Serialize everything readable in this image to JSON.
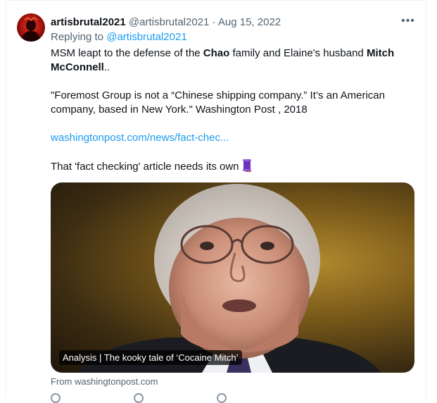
{
  "tweet": {
    "display_name": "artisbrutal2021",
    "handle": "@artisbrutal2021",
    "separator": "·",
    "date": "Aug 15, 2022",
    "more_icon": "ellipsis-icon",
    "replying_prefix": "Replying to",
    "replying_handle": "@artisbrutal2021",
    "para1": {
      "a": "MSM leapt to the defense of the ",
      "b": "Chao",
      "c": " family and Elaine's husband ",
      "d": "Mitch McConnell",
      "e": ".."
    },
    "para2": "\"Foremost Group is not a “Chinese shipping company.” It’s an American company, based in New York.\" Washington Post , 2018",
    "link": "washingtonpost.com/news/fact-chec...",
    "para4": "That 'fact checking' article needs its own",
    "para4_emoji": "scroll-emoji"
  },
  "card": {
    "caption": "Analysis | The kooky tale of ‘Cocaine Mitch’",
    "source": "From washingtonpost.com"
  },
  "colors": {
    "link": "#1d9bf0",
    "secondary_text": "#536471",
    "primary_text": "#0f1419"
  }
}
